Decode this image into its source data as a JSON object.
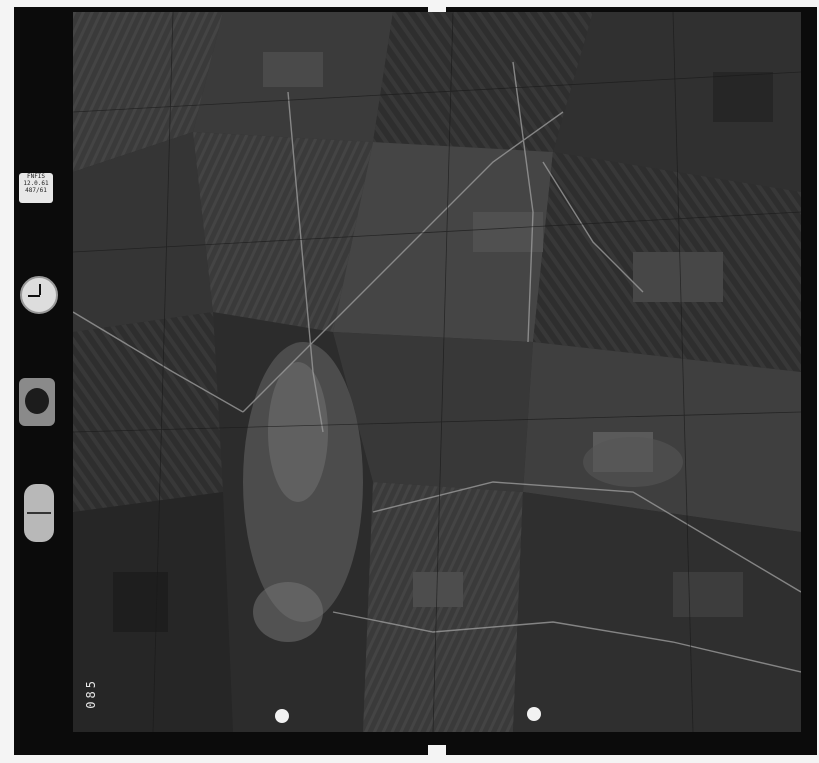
{
  "image": {
    "subject": "aerial-photograph",
    "colors": {
      "film_border": "#0b0b0b",
      "page_background": "#f4f4f4",
      "photo_base": "#2a2a2a"
    }
  },
  "strip": {
    "label_lines": [
      "FNFIS",
      "12.0.61",
      "487/61"
    ],
    "frame_number": "085"
  }
}
